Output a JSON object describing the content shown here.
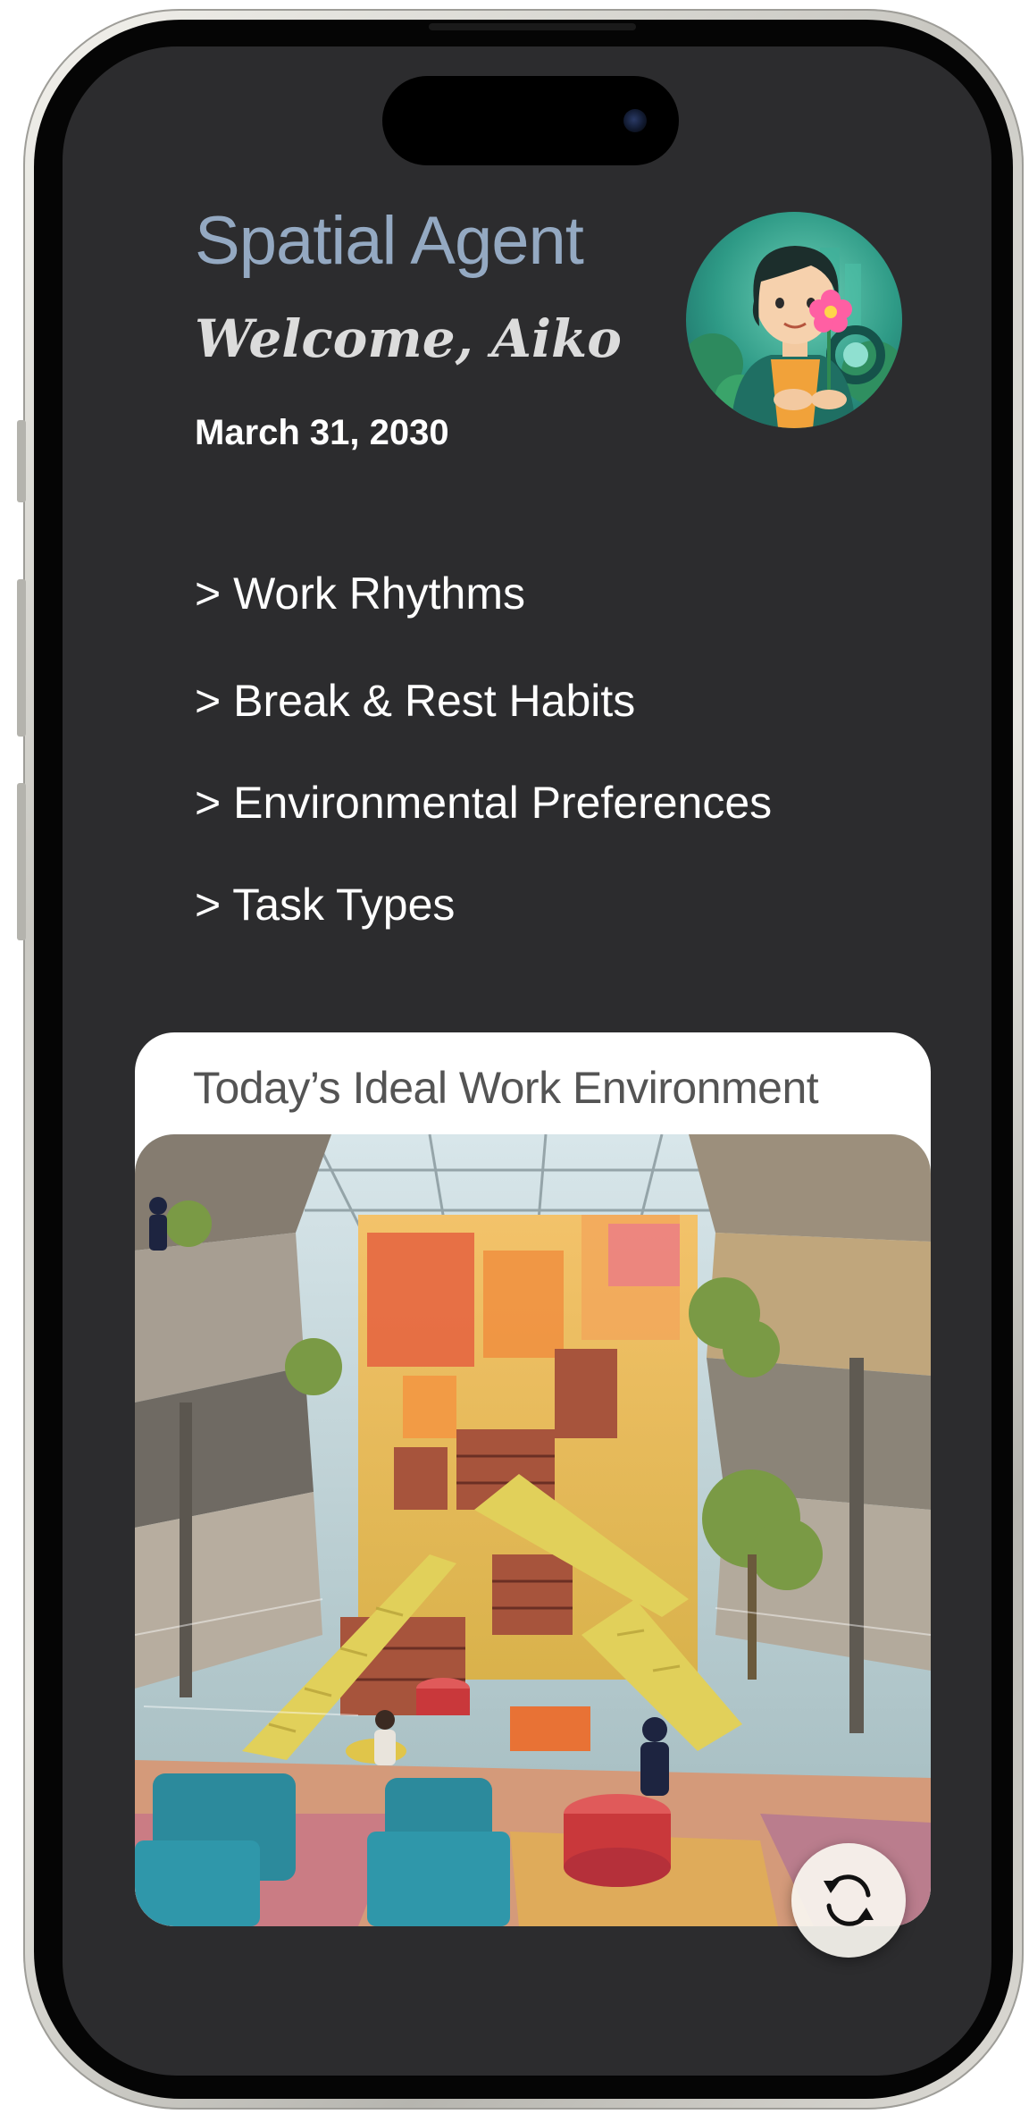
{
  "app": {
    "title": "Spatial Agent",
    "welcome": "Welcome, Aiko",
    "date": "March 31, 2030"
  },
  "menu": {
    "items": [
      {
        "label": "> Work Rhythms"
      },
      {
        "label": "> Break & Rest Habits"
      },
      {
        "label": "> Environmental Preferences"
      },
      {
        "label": "> Task Types"
      }
    ]
  },
  "environment_card": {
    "title": "Today’s Ideal Work Environment"
  },
  "icons": {
    "avatar": "illustrated-avatar-woman-with-flower",
    "refresh": "refresh-icon",
    "environment_image": "atrium-library-photo"
  },
  "colors": {
    "screen_background": "#2c2c2e",
    "title_accent": "#94a9c2",
    "card_background": "#ffffff"
  }
}
